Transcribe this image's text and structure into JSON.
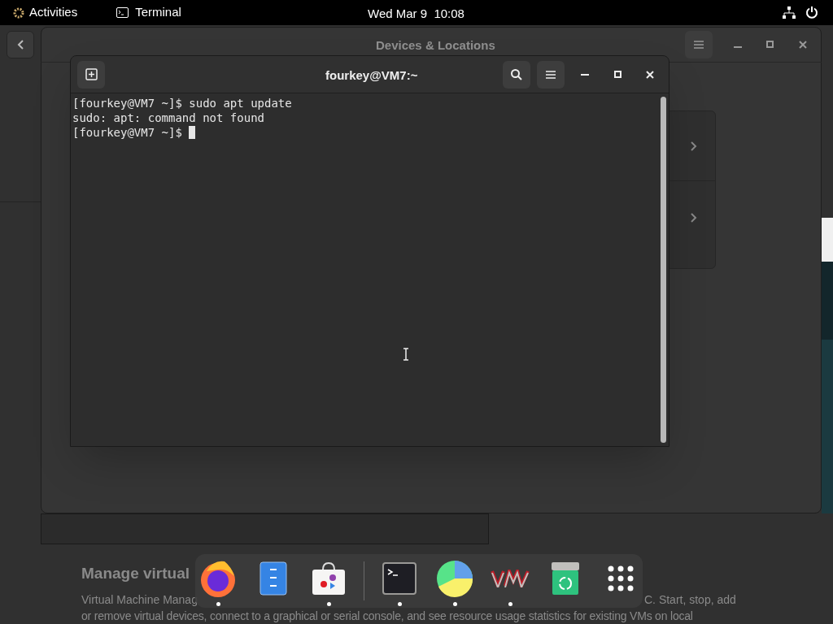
{
  "top_bar": {
    "activities": "Activities",
    "app_menu": "Terminal",
    "clock": "Wed Mar 9  10:08"
  },
  "background_app": {
    "heading": "Manage virtual",
    "description_left": "Virtual Machine Manag",
    "description_right": "C. Start, stop, add",
    "description_line_2": "or remove virtual devices, connect to a graphical or serial console, and see resource usage statistics for existing VMs on local"
  },
  "settings_window": {
    "title": "Devices & Locations"
  },
  "terminal": {
    "title": "fourkey@VM7:~",
    "lines": [
      "[fourkey@VM7 ~]$ sudo apt update",
      "sudo: apt: command not found",
      "[fourkey@VM7 ~]$ "
    ]
  },
  "dock": {
    "items": [
      {
        "kind": "firefox",
        "running": true
      },
      {
        "kind": "files",
        "running": false
      },
      {
        "kind": "software",
        "running": true
      },
      {
        "kind": "separator"
      },
      {
        "kind": "terminal",
        "running": true
      },
      {
        "kind": "disk-usage",
        "running": true
      },
      {
        "kind": "vm-manager",
        "running": true
      },
      {
        "kind": "recycle",
        "running": false
      },
      {
        "kind": "apps-grid",
        "running": false
      }
    ]
  }
}
